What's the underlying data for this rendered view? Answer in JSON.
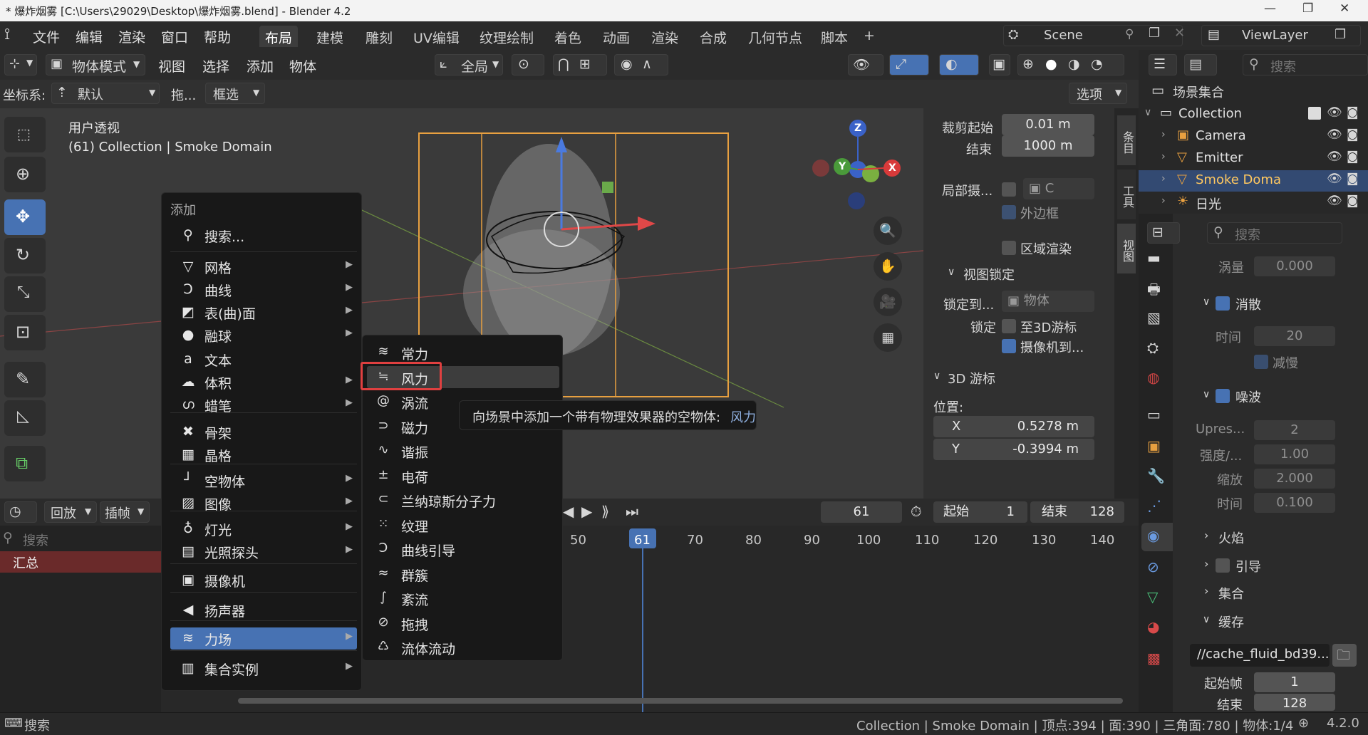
{
  "window": {
    "title": "* 爆炸烟雾 [C:\\Users\\29029\\Desktop\\爆炸烟雾.blend] - Blender 4.2"
  },
  "menubar": {
    "items": [
      "文件",
      "编辑",
      "渲染",
      "窗口",
      "帮助"
    ],
    "workspaces": [
      "布局",
      "建模",
      "雕刻",
      "UV编辑",
      "纹理绘制",
      "着色",
      "动画",
      "渲染",
      "合成",
      "几何节点",
      "脚本"
    ],
    "add_tab": "+",
    "scene": "Scene",
    "view_layer": "ViewLayer"
  },
  "viewport_header": {
    "mode": "物体模式",
    "menus": [
      "视图",
      "选择",
      "添加",
      "物体"
    ],
    "orientation": "全局",
    "coord_label": "坐标系:",
    "coord_value": "默认",
    "drag_label": "拖...",
    "select_mode": "框选",
    "options": "选项"
  },
  "viewport": {
    "view_name": "用户透视",
    "context": "(61) Collection | Smoke Domain",
    "gizmo": {
      "x": "X",
      "y": "Y",
      "z": "Z"
    }
  },
  "npanel": {
    "tabs": [
      "条目",
      "工具",
      "视图"
    ],
    "clip_start_label": "裁剪起始",
    "clip_start": "0.01 m",
    "clip_end_label": "结束",
    "clip_end": "1000 m",
    "local_camera_label": "局部摄...",
    "local_camera_value": "C",
    "bounding_box": "外边框",
    "region_render": "区域渲染",
    "view_lock_header": "视图锁定",
    "lock_to_label": "锁定到...",
    "lock_to_value": "物体",
    "lock_label": "锁定",
    "to_3d_cursor": "至3D游标",
    "camera_to": "摄像机到...",
    "cursor_header": "3D 游标",
    "location_label": "位置:",
    "x_label": "X",
    "x_value": "0.5278 m",
    "y_label": "Y",
    "y_value": "-0.3994 m"
  },
  "add_menu": {
    "title": "添加",
    "search": "搜索...",
    "items": [
      {
        "label": "网格",
        "icon": "mesh-icon",
        "glyph": "▽",
        "sub": true
      },
      {
        "label": "曲线",
        "icon": "curve-icon",
        "glyph": "Ͻ",
        "sub": true
      },
      {
        "label": "表(曲)面",
        "icon": "surface-icon",
        "glyph": "◩",
        "sub": true
      },
      {
        "label": "融球",
        "icon": "metaball-icon",
        "glyph": "●",
        "sub": true
      },
      {
        "label": "文本",
        "icon": "text-icon",
        "glyph": "a",
        "sub": false
      },
      {
        "label": "体积",
        "icon": "volume-icon",
        "glyph": "☁",
        "sub": true
      },
      {
        "label": "蜡笔",
        "icon": "grease-pencil-icon",
        "glyph": "ഗ",
        "sub": true
      },
      {
        "label": "骨架",
        "icon": "armature-icon",
        "glyph": "✖",
        "sub": false
      },
      {
        "label": "晶格",
        "icon": "lattice-icon",
        "glyph": "▦",
        "sub": false
      },
      {
        "label": "空物体",
        "icon": "empty-icon",
        "glyph": "┘",
        "sub": true
      },
      {
        "label": "图像",
        "icon": "image-icon",
        "glyph": "▨",
        "sub": true
      },
      {
        "label": "灯光",
        "icon": "light-icon",
        "glyph": "♁",
        "sub": true
      },
      {
        "label": "光照探头",
        "icon": "light-probe-icon",
        "glyph": "▤",
        "sub": true
      },
      {
        "label": "摄像机",
        "icon": "camera-icon",
        "glyph": "▣",
        "sub": false
      },
      {
        "label": "扬声器",
        "icon": "speaker-icon",
        "glyph": "◀",
        "sub": false
      },
      {
        "label": "力场",
        "icon": "force-field-icon",
        "glyph": "≋",
        "sub": true
      },
      {
        "label": "集合实例",
        "icon": "collection-instance-icon",
        "glyph": "▥",
        "sub": true
      }
    ]
  },
  "force_submenu": {
    "items": [
      {
        "label": "常力",
        "icon": "force-icon",
        "glyph": "≋"
      },
      {
        "label": "风力",
        "icon": "wind-icon",
        "glyph": "≒"
      },
      {
        "label": "涡流",
        "icon": "vortex-icon",
        "glyph": "@"
      },
      {
        "label": "磁力",
        "icon": "magnet-icon",
        "glyph": "⊃"
      },
      {
        "label": "谐振",
        "icon": "harmonic-icon",
        "glyph": "∿"
      },
      {
        "label": "电荷",
        "icon": "charge-icon",
        "glyph": "±"
      },
      {
        "label": "兰纳琼斯分子力",
        "icon": "lennard-jones-icon",
        "glyph": "⊂"
      },
      {
        "label": "纹理",
        "icon": "texture-icon",
        "glyph": "⁙"
      },
      {
        "label": "曲线引导",
        "icon": "curve-guide-icon",
        "glyph": "Ͻ"
      },
      {
        "label": "群簇",
        "icon": "boid-icon",
        "glyph": "≈"
      },
      {
        "label": "紊流",
        "icon": "turbulence-icon",
        "glyph": "∫"
      },
      {
        "label": "拖拽",
        "icon": "drag-icon",
        "glyph": "⊘"
      },
      {
        "label": "流体流动",
        "icon": "fluid-flow-icon",
        "glyph": "♺"
      }
    ]
  },
  "tooltip": {
    "text": "向场景中添加一个带有物理效果器的空物体:",
    "name": "风力"
  },
  "timeline": {
    "playback": "回放",
    "keying": "插帧",
    "search_placeholder": "搜索",
    "summary": "汇总",
    "current_frame": "61",
    "start_label": "起始",
    "start": "1",
    "end_label": "结束",
    "end": "128",
    "ticks": [
      "50",
      "61",
      "70",
      "80",
      "90",
      "100",
      "110",
      "120",
      "130",
      "140"
    ]
  },
  "outliner": {
    "search_placeholder": "搜索",
    "scene_collection": "场景集合",
    "items": [
      {
        "label": "Collection",
        "icon": "collection-icon"
      },
      {
        "label": "Camera",
        "icon": "camera-icon"
      },
      {
        "label": "Emitter",
        "icon": "mesh-icon"
      },
      {
        "label": "Smoke Doma",
        "icon": "mesh-icon"
      },
      {
        "label": "日光",
        "icon": "sun-icon"
      }
    ]
  },
  "properties": {
    "search_placeholder": "搜索",
    "vorticity_label": "涡量",
    "vorticity": "0.000",
    "dissolve_label": "消散",
    "time_label": "时间",
    "time": "20",
    "slow_label": "减慢",
    "noise_label": "噪波",
    "upres_label": "Upres...",
    "upres": "2",
    "strength_label": "强度/...",
    "strength": "1.00",
    "scale_label": "缩放",
    "scale": "2.000",
    "noise_time_label": "时间",
    "noise_time": "0.100",
    "fire_label": "火焰",
    "guide_label": "引导",
    "collection_label": "集合",
    "cache_label": "缓存",
    "cache_path": "//cache_fluid_bd39...",
    "start_frame_label": "起始帧",
    "start_frame": "1",
    "end_label": "结束",
    "end": "128"
  },
  "statusbar": {
    "search": "搜索",
    "stats": "Collection | Smoke Domain | 顶点:394 | 面:390 | 三角面:780 | 物体:1/4",
    "version": "4.2.0"
  },
  "colors": {
    "accent": "#4772b3",
    "highlight_box": "#e04040",
    "orange": "#e8a040"
  }
}
